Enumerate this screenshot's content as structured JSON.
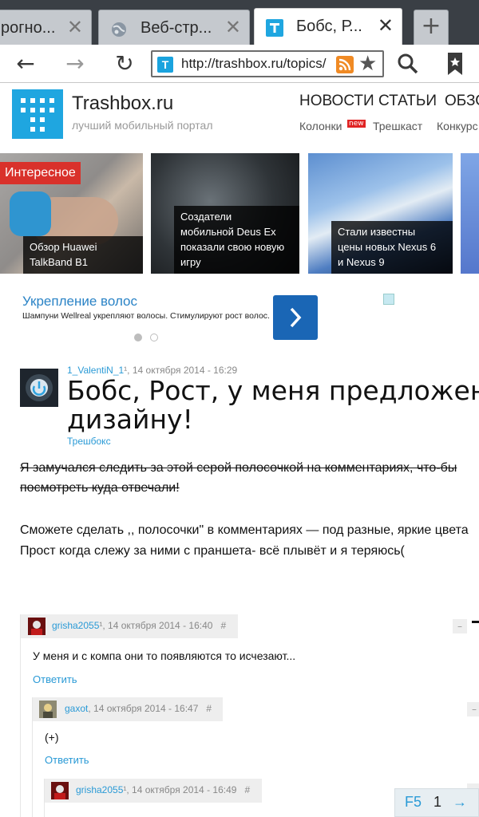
{
  "browser": {
    "tabs": [
      {
        "label": "рогно...",
        "close": "✕"
      },
      {
        "label": "Веб-стр...",
        "close": "✕"
      },
      {
        "label": "Бобс, Р...",
        "close": "✕"
      }
    ],
    "new_tab": "+",
    "url": "http://trashbox.ru/topics/",
    "back": "←",
    "forward": "→",
    "refresh": "↻",
    "search": "⚲",
    "star": "★"
  },
  "site": {
    "name": "Trashbox.ru",
    "tagline": "лучший мобильный портал",
    "nav_main": [
      "НОВОСТИ",
      "СТАТЬИ",
      "ОБЗО"
    ],
    "nav_sub": [
      "Колонки",
      "Трешкаст",
      "Конкурс"
    ],
    "new_badge": "new",
    "brand_color": "#1fa6e0"
  },
  "featured": {
    "badge": "Интересное",
    "items": [
      {
        "caption": [
          "Обзор Huawei",
          "TalkBand B1"
        ]
      },
      {
        "caption": [
          "Создатели",
          "мобильной Deus Ex",
          "показали свою новую",
          "игру"
        ]
      },
      {
        "caption": [
          "Стали известны",
          "цены новых Nexus 6",
          "и Nexus 9"
        ]
      }
    ]
  },
  "ad": {
    "title": "Укрепление волос",
    "text": "Шампуни Wellreal укрепляют волосы. Стимулируют рост волос.",
    "button": "›"
  },
  "article": {
    "author": "1_ValentiN_1",
    "author_sup": "¹",
    "date": ", 14 октября 2014 - 16:29",
    "title_line1": "Бобс, Рост, у меня предложения по",
    "title_line2": "дизайну!",
    "category": "Трешбокс",
    "strike_line1": "Я замучался следить за этой серой полосочкой на комментариях, что-бы",
    "strike_line2": "посмотреть куда отвечали!",
    "line3": "Сможете сделать ,, полосочки\" в комментариях — под разные, яркие цвета",
    "line4": "Прост когда слежу за ними с праншета- всё плывёт и я теряюсь("
  },
  "comments": [
    {
      "user": "grisha2055",
      "sup": "¹",
      "date": ", 14 октября 2014 - 16:40",
      "hash": "#",
      "text": "У меня и с компа они то появляются то исчезают...",
      "reply": "Ответить",
      "minus": "–"
    },
    {
      "user": "gaxot",
      "sup": "",
      "date": ", 14 октября 2014 - 16:47",
      "hash": "#",
      "text": "(+)",
      "reply": "Ответить",
      "minus": "–"
    },
    {
      "user": "grisha2055",
      "sup": "¹",
      "date": ", 14 октября 2014 - 16:49",
      "hash": "#",
      "text": "",
      "reply": "",
      "minus": "–"
    }
  ],
  "pager": {
    "refresh": "F5",
    "page": "1",
    "next": "→"
  }
}
